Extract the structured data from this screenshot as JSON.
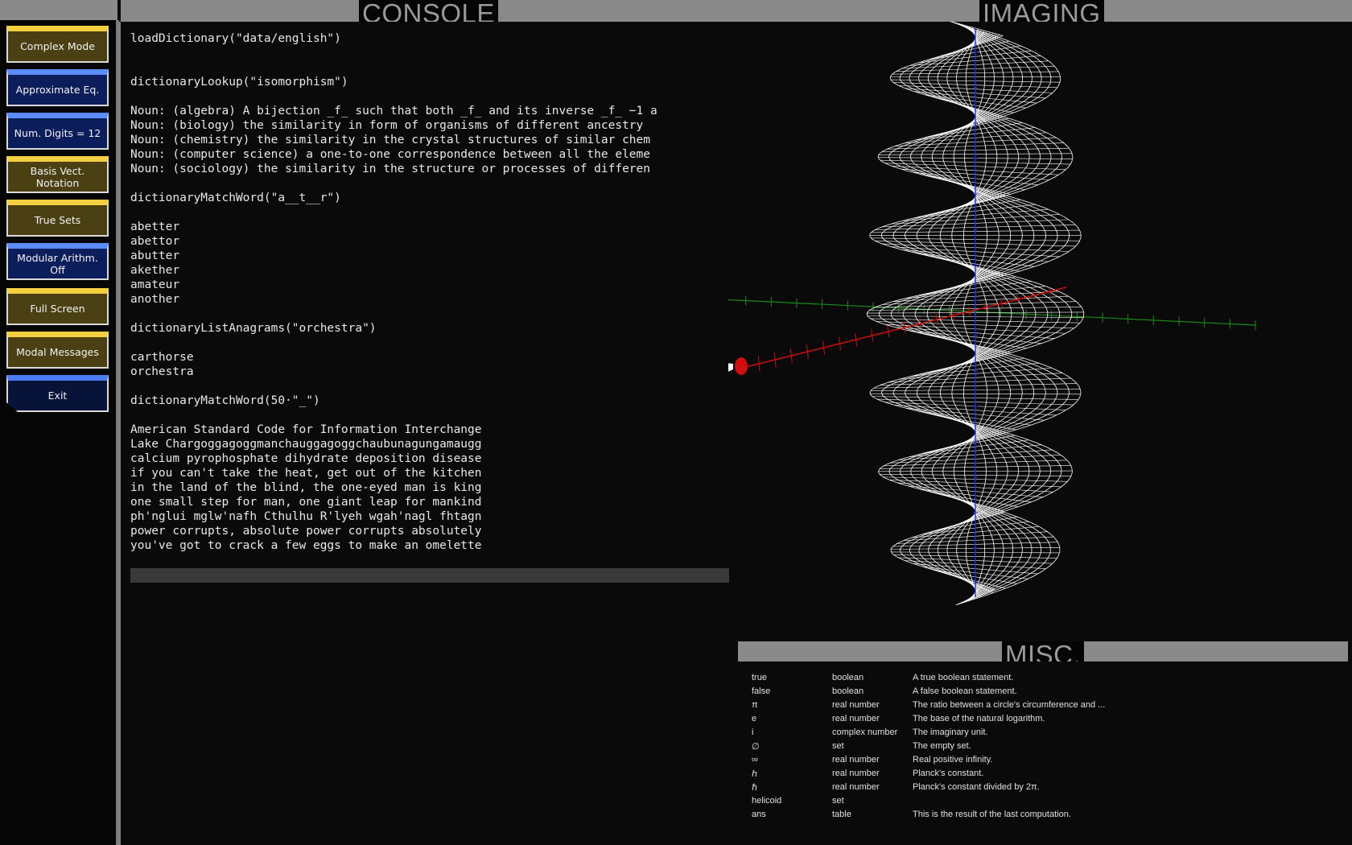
{
  "sidebar": {
    "buttons": [
      {
        "label": "Complex Mode",
        "style": "gold"
      },
      {
        "label": "Approximate Eq.",
        "style": "blue"
      },
      {
        "label": "Num. Digits = 12",
        "style": "blue"
      },
      {
        "label": "Basis Vect. Notation",
        "style": "gold"
      },
      {
        "label": "True Sets",
        "style": "gold"
      },
      {
        "label": "Modular Arithm. Off",
        "style": "blue"
      },
      {
        "label": "Full Screen",
        "style": "gold"
      },
      {
        "label": "Modal Messages",
        "style": "gold"
      },
      {
        "label": "Exit",
        "style": "exit"
      }
    ]
  },
  "console": {
    "title": "CONSOLE",
    "lines": [
      "loadDictionary(\"data/english\")",
      "",
      "",
      "dictionaryLookup(\"isomorphism\")",
      "",
      "Noun: (algebra) A bijection _f_ such that both _f_ and its inverse _f_ −1 a",
      "Noun: (biology) the similarity in form of organisms of different ancestry",
      "Noun: (chemistry) the similarity in the crystal structures of similar chem",
      "Noun: (computer science) a one-to-one correspondence between all the eleme",
      "Noun: (sociology) the similarity in the structure or processes of differen",
      "",
      "dictionaryMatchWord(\"a__t__r\")",
      "",
      "abetter",
      "abettor",
      "abutter",
      "akether",
      "amateur",
      "another",
      "",
      "dictionaryListAnagrams(\"orchestra\")",
      "",
      "carthorse",
      "orchestra",
      "",
      "dictionaryMatchWord(50·\"_\")",
      "",
      "American Standard Code for Information Interchange",
      "Lake Chargoggagoggmanchauggagoggchaubunagungamaugg",
      "calcium pyrophosphate dihydrate deposition disease",
      "if you can't take the heat, get out of the kitchen",
      "in the land of the blind, the one-eyed man is king",
      "one small step for man, one giant leap for mankind",
      "ph'nglui mglw'nafh Cthulhu R'lyeh wgah'nagl fhtagn",
      "power corrupts, absolute power corrupts absolutely",
      "you've got to crack a few eggs to make an omelette"
    ],
    "input_value": ""
  },
  "imaging": {
    "title": "IMAGING",
    "colors": {
      "x_axis": "#d01010",
      "y_axis": "#1a8a1a",
      "z_axis": "#2030d0",
      "mesh": "#ffffff"
    }
  },
  "misc": {
    "title": "MISC.",
    "rows": [
      {
        "name": "true",
        "type": "boolean",
        "description": "A true boolean statement."
      },
      {
        "name": "false",
        "type": "boolean",
        "description": "A false boolean statement."
      },
      {
        "name": "π",
        "type": "real number",
        "description": "The ratio between a circle's circumference and ..."
      },
      {
        "name": "e",
        "type": "real number",
        "description": "The base of the natural logarithm."
      },
      {
        "name": "i",
        "type": "complex number",
        "description": "The imaginary unit."
      },
      {
        "name": "∅",
        "type": "set",
        "description": "The empty set."
      },
      {
        "name": "∞",
        "type": "real number",
        "description": "Real positive infinity."
      },
      {
        "name": "ℎ",
        "type": "real number",
        "description": "Planck's constant."
      },
      {
        "name": "ℏ",
        "type": "real number",
        "description": "Planck's constant divided by 2π."
      },
      {
        "name": "helicoid",
        "type": "set",
        "description": ""
      },
      {
        "name": "ans",
        "type": "table",
        "description": "This is the result of the last computation."
      }
    ]
  }
}
